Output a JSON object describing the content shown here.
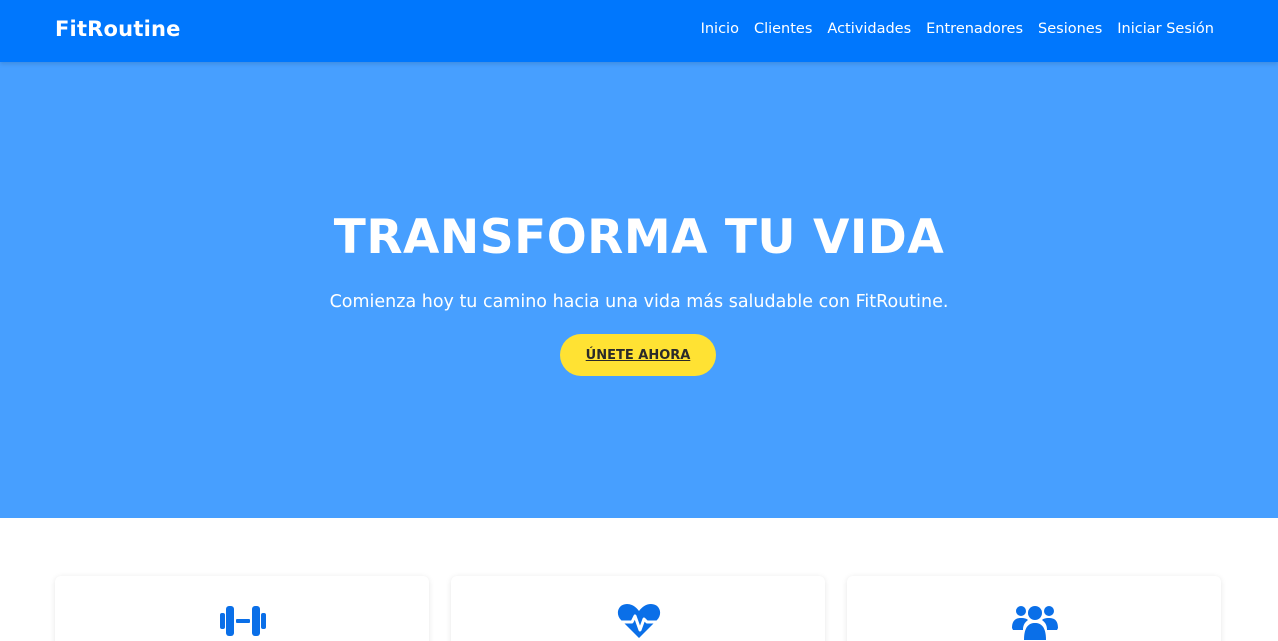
{
  "nav": {
    "brand": "FitRoutine",
    "links": [
      "Inicio",
      "Clientes",
      "Actividades",
      "Entrenadores",
      "Sesiones",
      "Iniciar Sesión"
    ]
  },
  "hero": {
    "title": "TRANSFORMA TU VIDA",
    "subtitle": "Comienza hoy tu camino hacia una vida más saludable con FitRoutine.",
    "cta": "ÚNETE AHORA"
  },
  "features": {
    "icons": [
      "dumbbell-icon",
      "heartbeat-icon",
      "users-icon"
    ]
  },
  "colors": {
    "navbar": "#0077fd",
    "hero": "#479fff",
    "cta": "#ffe233",
    "icon": "#0a6fe8"
  }
}
